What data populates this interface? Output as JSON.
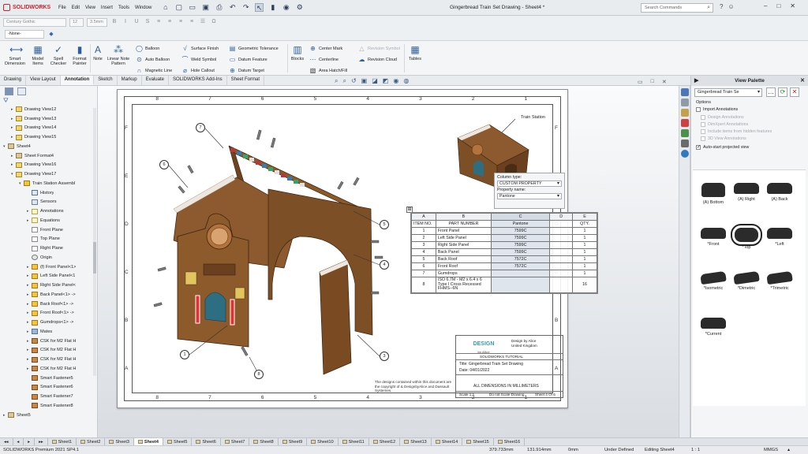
{
  "app": {
    "name": "SOLIDWORKS",
    "doc_title": "Gingerbread Train Set Drawing - Sheet4 *"
  },
  "menu": [
    "File",
    "Edit",
    "View",
    "Insert",
    "Tools",
    "Window"
  ],
  "search": {
    "placeholder": "Search Commands"
  },
  "fontbar": {
    "font": "Century Gothic",
    "size": "12",
    "height": "3.5mm"
  },
  "layerbar": {
    "layer": "-None-"
  },
  "ribbon": {
    "smart_dimension": "Smart Dimension",
    "model_items": "Model Items",
    "spell_checker": "Spell Checker",
    "format_painter": "Format Painter",
    "note": "Note",
    "linear_note_pattern": "Linear Note Pattern",
    "balloon": "Balloon",
    "auto_balloon": "Auto Balloon",
    "magnetic_line": "Magnetic Line",
    "surface_finish": "Surface Finish",
    "weld_symbol": "Weld Symbol",
    "hole_callout": "Hole Callout",
    "geometric_tolerance": "Geometric Tolerance",
    "datum_feature": "Datum Feature",
    "datum_target": "Datum Target",
    "blocks": "Blocks",
    "center_mark": "Center Mark",
    "centerline": "Centerline",
    "area_hatch": "Area Hatch/Fill",
    "revision_symbol": "Revision Symbol",
    "revision_cloud": "Revision Cloud",
    "tables": "Tables"
  },
  "tabs": [
    "Drawing",
    "View Layout",
    "Annotation",
    "Sketch",
    "Markup",
    "Evaluate",
    "SOLIDWORKS Add-Ins",
    "Sheet Format"
  ],
  "active_tab": "Annotation",
  "tree": [
    {
      "label": "Drawing View12",
      "type": "view",
      "level": 1
    },
    {
      "label": "Drawing View13",
      "type": "view",
      "level": 1
    },
    {
      "label": "Drawing View14",
      "type": "view",
      "level": 1
    },
    {
      "label": "Drawing View15",
      "type": "view",
      "level": 1
    },
    {
      "label": "Sheet4",
      "type": "sheet",
      "level": 0
    },
    {
      "label": "Sheet Format4",
      "type": "sheet",
      "level": 1
    },
    {
      "label": "Drawing View16",
      "type": "view",
      "level": 1
    },
    {
      "label": "Drawing View17",
      "type": "view",
      "level": 1
    },
    {
      "label": "Train Station Assembl",
      "type": "part",
      "level": 2
    },
    {
      "label": "History",
      "type": "hist",
      "level": 3
    },
    {
      "label": "Sensors",
      "type": "sens",
      "level": 3
    },
    {
      "label": "Annotations",
      "type": "annot",
      "level": 3
    },
    {
      "label": "Equations",
      "type": "annot",
      "level": 3
    },
    {
      "label": "Front Plane",
      "type": "plane",
      "level": 3
    },
    {
      "label": "Top Plane",
      "type": "plane",
      "level": 3
    },
    {
      "label": "Right Plane",
      "type": "plane",
      "level": 3
    },
    {
      "label": "Origin",
      "type": "orig",
      "level": 3
    },
    {
      "label": "(f) Front Panel<1>",
      "type": "part",
      "level": 3
    },
    {
      "label": "Left Side Panel<1",
      "type": "part",
      "level": 3
    },
    {
      "label": "Right Side Panel<",
      "type": "part",
      "level": 3
    },
    {
      "label": "Back Panel<1> ->",
      "type": "part",
      "level": 3
    },
    {
      "label": "Back Roof<1> ->",
      "type": "part",
      "level": 3
    },
    {
      "label": "Front Roof<1> ->",
      "type": "part",
      "level": 3
    },
    {
      "label": "Gumdrops<1> ->",
      "type": "part",
      "level": 3
    },
    {
      "label": "Mates",
      "type": "fold",
      "level": 3
    },
    {
      "label": "CSK for M2 Flat H",
      "type": "fast",
      "level": 3
    },
    {
      "label": "CSK for M2 Flat H",
      "type": "fast",
      "level": 3
    },
    {
      "label": "CSK for M2 Flat H",
      "type": "fast",
      "level": 3
    },
    {
      "label": "CSK for M2 Flat H",
      "type": "fast",
      "level": 3
    },
    {
      "label": "Smart Fastener5",
      "type": "fast",
      "level": 3
    },
    {
      "label": "Smart Fastener6",
      "type": "fast",
      "level": 3
    },
    {
      "label": "Smart Fastener7",
      "type": "fast",
      "level": 3
    },
    {
      "label": "Smart Fastener8",
      "type": "fast",
      "level": 3
    },
    {
      "label": "Sheet5",
      "type": "sheet",
      "level": 0
    }
  ],
  "sheet": {
    "zones_top": [
      "8",
      "7",
      "6",
      "5",
      "4",
      "3",
      "2",
      "1"
    ],
    "zones_side": [
      "F",
      "E",
      "D",
      "C",
      "B",
      "A"
    ],
    "train_station_label": "Train Station",
    "callouts": [
      "7",
      "6",
      "5",
      "4",
      "3",
      "1",
      "8"
    ]
  },
  "column_popup": {
    "column_type_label": "Column type:",
    "column_type": "CUSTOM PROPERTY",
    "property_name_label": "Property name:",
    "property_name": "Pantone"
  },
  "bom": {
    "col_letters": [
      "A",
      "B",
      "C",
      "D",
      "E"
    ],
    "headers": [
      "ITEM NO.",
      "PART NUMBER",
      "Pantone",
      "QTY."
    ],
    "rows": [
      [
        "1",
        "Front Panel",
        "7599C",
        "1"
      ],
      [
        "2",
        "Left Side Panel",
        "7599C",
        "1"
      ],
      [
        "3",
        "Right Side Panel",
        "7599C",
        "1"
      ],
      [
        "4",
        "Back Panel",
        "7599C",
        "1"
      ],
      [
        "5",
        "Back Roof",
        "7572C",
        "1"
      ],
      [
        "6",
        "Front Roof",
        "7572C",
        "1"
      ],
      [
        "7",
        "Gumdrops",
        "",
        "1"
      ],
      [
        "8",
        "ISO 6.7M - M2 x 6.4 x 6 Type I Cross Recessed FHMS--6N",
        "",
        "16"
      ]
    ]
  },
  "title_block": {
    "design_by": "Design by Alice",
    "country": "United Kingdom",
    "tutorial": "SOLIDWORKS TUTORIAL",
    "title": "Title: Gingerbread Train Set Drawing",
    "date": "Date: 04/01/2022",
    "units_note": "ALL DIMENSIONS IN MILLIMETERS",
    "scale": "Scale 1:1",
    "do_not_scale": "Do not Scale Drawing",
    "sheet": "Sheet 4 Of 6",
    "copyright": "The designs contained within this document are the copyright of & DesignbyAlice and Dassault Systemes."
  },
  "view_palette": {
    "title": "View Palette",
    "document": "Gingerbread Train Se",
    "options_label": "Options",
    "import_annotations": "Import Annotations",
    "design_annotations": "Design Annotations",
    "dimxpert_annotations": "DimXpert Annotations",
    "hidden_features": "Include items from hidden features",
    "view_annotations": "3D View Annotations",
    "auto_start": "Auto-start projected view",
    "views": [
      "(A) Bottom",
      "(A) Right",
      "(A) Back",
      "*Front",
      "*Top",
      "*Left",
      "*Isometric",
      "*Dimetric",
      "*Trimetric",
      "*Current"
    ]
  },
  "sheet_tabs": [
    "Sheet1",
    "Sheet2",
    "Sheet3",
    "Sheet4",
    "Sheet5",
    "Sheet6",
    "Sheet7",
    "Sheet8",
    "Sheet9",
    "Sheet10",
    "Sheet11",
    "Sheet12",
    "Sheet13",
    "Sheet14",
    "Sheet15",
    "Sheet16"
  ],
  "active_sheet": "Sheet4",
  "status": {
    "version": "SOLIDWORKS Premium 2021 SP4.1",
    "x": "379.733mm",
    "y": "131.914mm",
    "z": "0mm",
    "state": "Under Defined",
    "editing": "Editing Sheet4",
    "scale": "1 : 1",
    "units": "MMGS"
  }
}
